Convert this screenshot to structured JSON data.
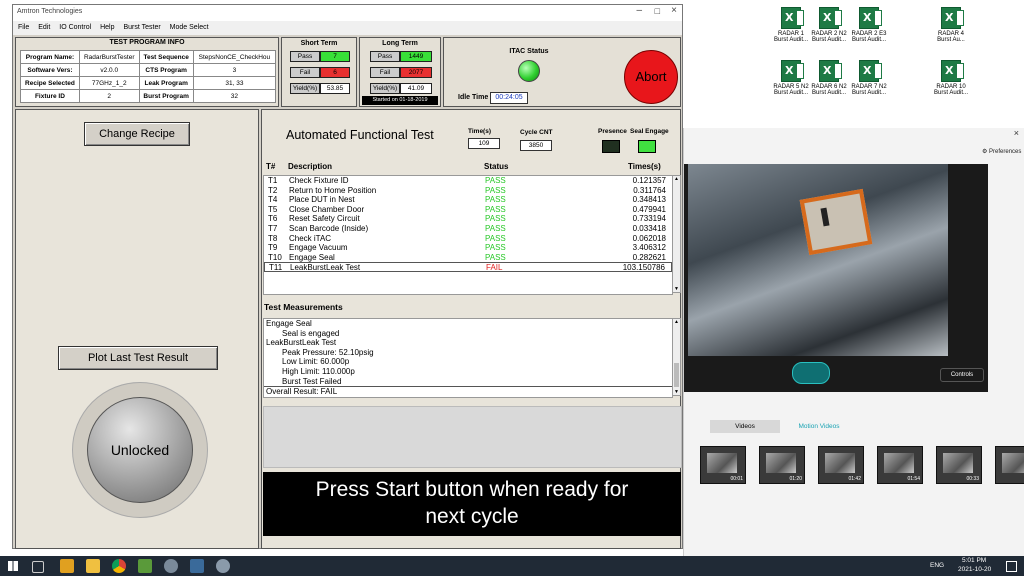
{
  "window": {
    "title": "Amtron Technologies"
  },
  "menu": [
    "File",
    "Edit",
    "IO Control",
    "Help",
    "Burst Tester",
    "Mode Select"
  ],
  "test_program_info": {
    "heading": "TEST PROGRAM INFO",
    "rows": [
      {
        "l1": "Program Name:",
        "v1": "RadarBurstTester",
        "l2": "Test Sequence",
        "v2": "StepsNonCE_CheckHou"
      },
      {
        "l1": "Software Vers:",
        "v1": "v2.0.0",
        "l2": "CTS Program",
        "v2": "3"
      },
      {
        "l1": "Recipe Selected",
        "v1": "77GHz_1_2",
        "l2": "Leak Program",
        "v2": "31, 33"
      },
      {
        "l1": "Fixture ID",
        "v1": "2",
        "l2": "Burst Program",
        "v2": "32"
      }
    ]
  },
  "short_term": {
    "heading": "Short Term",
    "pass_label": "Pass",
    "pass_value": "7",
    "fail_label": "Fail",
    "fail_value": "6",
    "yield_label": "Yield(%)",
    "yield_value": "53.85"
  },
  "long_term": {
    "heading": "Long Term",
    "pass_label": "Pass",
    "pass_value": "1449",
    "fail_label": "Fail",
    "fail_value": "2077",
    "yield_label": "Yield(%)",
    "yield_value": "41.09",
    "started": "Started on 01-18-2019"
  },
  "itac": {
    "label": "ITAC Status",
    "idle_label": "Idle Time",
    "idle_value": "00:24:05"
  },
  "abort_label": "Abort",
  "left": {
    "change_recipe": "Change Recipe",
    "plot_last": "Plot Last Test Result",
    "lock_state": "Unlocked"
  },
  "aft": {
    "title": "Automated Functional Test",
    "time_label": "Time(s)",
    "time_value": "109",
    "cycle_label": "Cycle CNT",
    "cycle_value": "3850",
    "presence_label": "Presence",
    "seal_label": "Seal Engage"
  },
  "table": {
    "headers": {
      "num": "T#",
      "desc": "Description",
      "status": "Status",
      "times": "Times(s)"
    },
    "rows": [
      {
        "num": "T1",
        "desc": "Check Fixture ID",
        "status": "PASS",
        "time": "0.121357"
      },
      {
        "num": "T2",
        "desc": "Return to Home Position",
        "status": "PASS",
        "time": "0.311764"
      },
      {
        "num": "T4",
        "desc": "Place DUT in Nest",
        "status": "PASS",
        "time": "0.348413"
      },
      {
        "num": "T5",
        "desc": "Close Chamber Door",
        "status": "PASS",
        "time": "0.479941"
      },
      {
        "num": "T6",
        "desc": "Reset Safety Circuit",
        "status": "PASS",
        "time": "0.733194"
      },
      {
        "num": "T7",
        "desc": "Scan Barcode (Inside)",
        "status": "PASS",
        "time": "0.033418"
      },
      {
        "num": "T8",
        "desc": "Check iTAC",
        "status": "PASS",
        "time": "0.062018"
      },
      {
        "num": "T9",
        "desc": "Engage Vacuum",
        "status": "PASS",
        "time": "3.406312"
      },
      {
        "num": "T10",
        "desc": "Engage Seal",
        "status": "PASS",
        "time": "0.282621"
      },
      {
        "num": "T11",
        "desc": "LeakBurstLeak Test",
        "status": "FAIL",
        "time": "103.150786"
      }
    ]
  },
  "measurements": {
    "heading": "Test Measurements",
    "lines": [
      {
        "text": "Engage Seal",
        "indent": false
      },
      {
        "text": "Seal is engaged",
        "indent": true
      },
      {
        "text": "LeakBurstLeak Test",
        "indent": false
      },
      {
        "text": "Peak Pressure: 52.10psig",
        "indent": true
      },
      {
        "text": "Low Limit:  60.000p",
        "indent": true
      },
      {
        "text": "High Limit:  110.000p",
        "indent": true
      },
      {
        "text": "Burst Test Failed",
        "indent": true
      },
      {
        "text": "Overall Result: FAIL",
        "indent": false
      }
    ]
  },
  "prompt": {
    "line1": "Press Start button when ready for",
    "line2": "next cycle"
  },
  "right_app": {
    "preferences": "Preferences",
    "controls": "Controls",
    "tab_videos": "Videos",
    "tab_motion": "Motion Videos"
  },
  "thumbs": [
    "00:01",
    "01:20",
    "01:42",
    "01:54",
    "00:33",
    ""
  ],
  "taskbar": {
    "lang": "ENG",
    "time": "5:01 PM",
    "date": "2021-10-20"
  },
  "colors": {
    "pass": "#28c828",
    "fail": "#e02020",
    "abort": "#e8161b",
    "itac_led": "#30d030"
  }
}
